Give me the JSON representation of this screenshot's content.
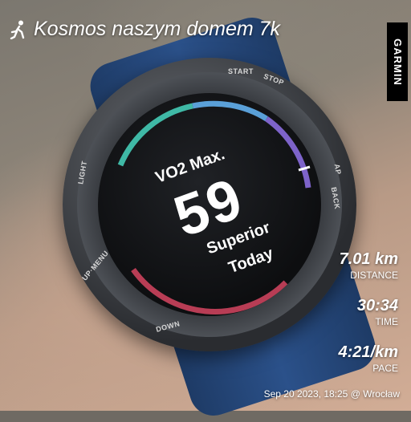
{
  "activity": {
    "title": "Kosmos naszym domem 7k",
    "icon": "runner-icon"
  },
  "brand": {
    "label": "GARMIN"
  },
  "watch": {
    "buttons": {
      "start": "START",
      "stop": "STOP",
      "light": "LIGHT",
      "ap": "AP",
      "back": "BACK",
      "up_menu": "UP·MENU",
      "down": "DOWN"
    },
    "screen": {
      "metric_label": "VO2 Max.",
      "value": "59",
      "rating": "Superior",
      "period": "Today"
    }
  },
  "stats": [
    {
      "value": "7.01 km",
      "label": "DISTANCE"
    },
    {
      "value": "30:34",
      "label": "TIME"
    },
    {
      "value": "4:21/km",
      "label": "PACE"
    }
  ],
  "footer": {
    "datetime_location": "Sep 20 2023, 18:25 @ Wrocław"
  },
  "colors": {
    "gauge_purple": "#7d63c9",
    "gauge_blue": "#5aa0d8",
    "gauge_teal": "#3fb9a6",
    "gauge_red": "#b83d55",
    "strap_blue": "#2b518a"
  }
}
